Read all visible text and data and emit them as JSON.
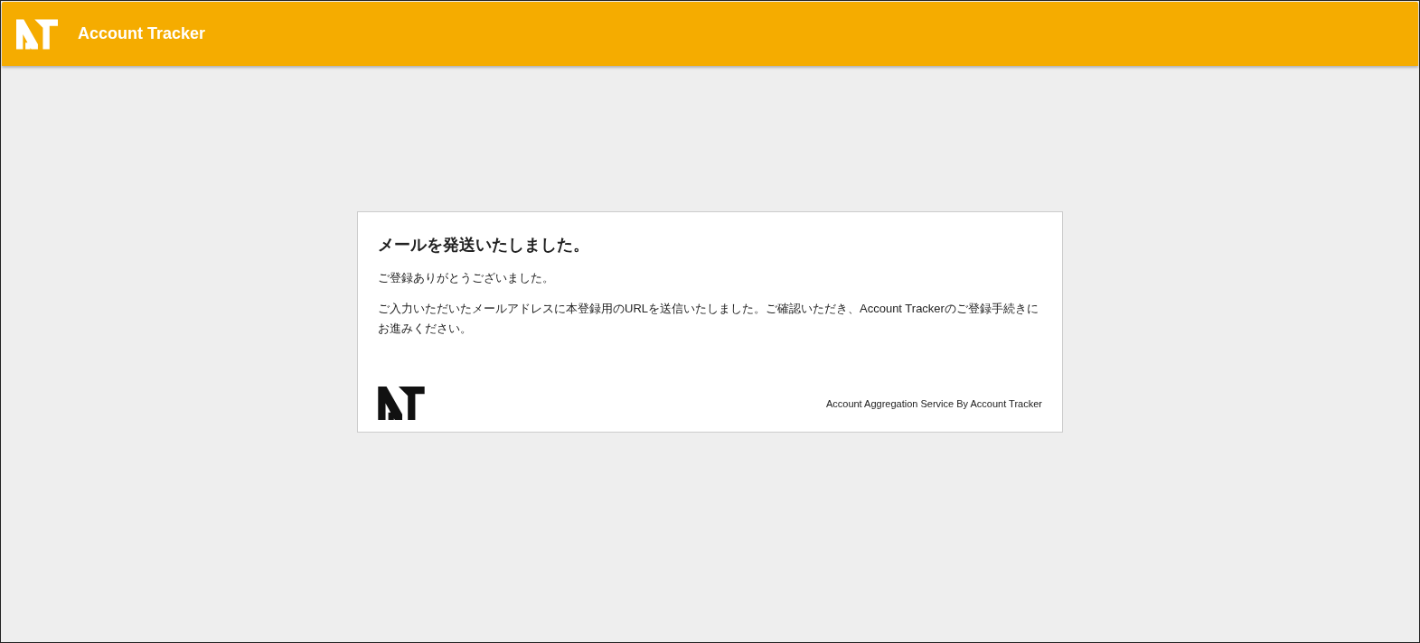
{
  "header": {
    "title": "Account Tracker"
  },
  "card": {
    "heading": "メールを発送いたしました。",
    "paragraphs": [
      "ご登録ありがとうございました。",
      "ご入力いただいたメールアドレスに本登録用のURLを送信いたしました。ご確認いただき、Account Trackerのご登録手続きにお進みください。"
    ],
    "footer_text": "Account Aggregation Service By Account Tracker"
  }
}
